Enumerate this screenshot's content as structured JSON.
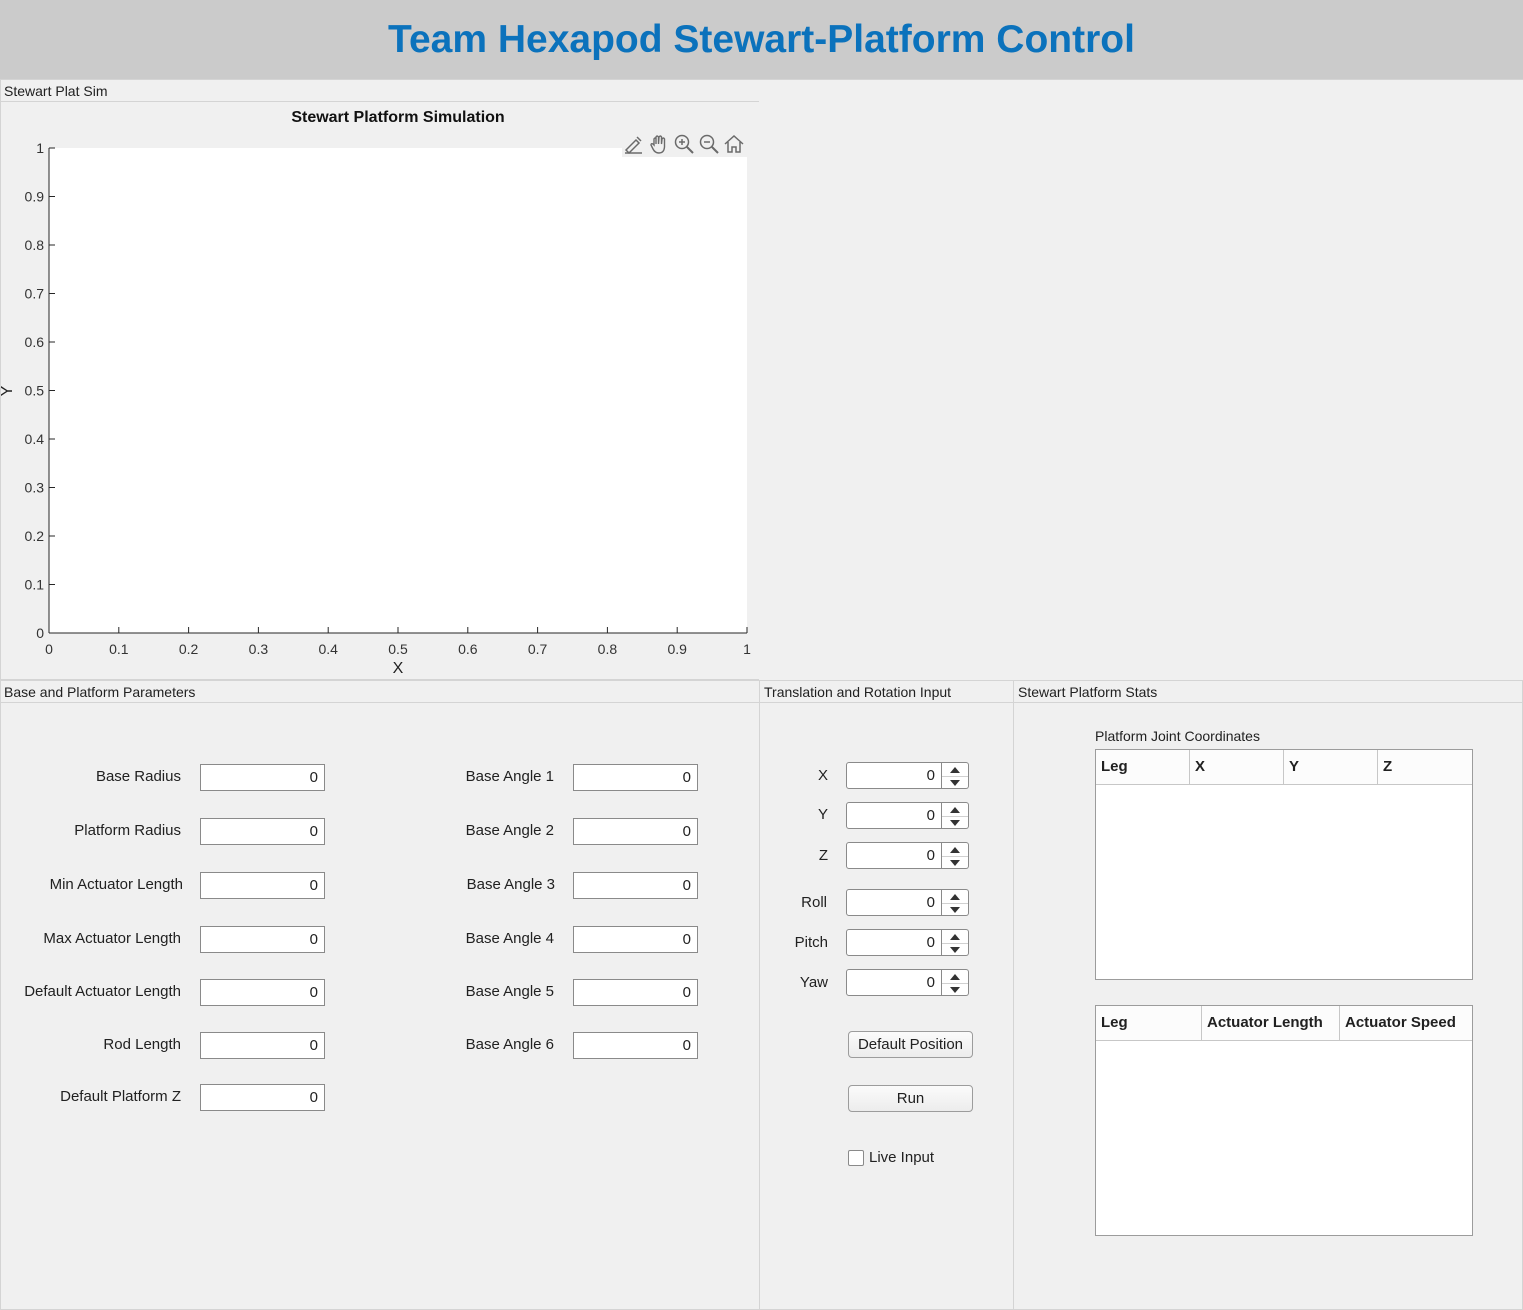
{
  "header": {
    "title": "Team Hexapod Stewart-Platform Control"
  },
  "sim_panel": {
    "title": "Stewart Plat Sim"
  },
  "chart_data": {
    "type": "line",
    "title": "Stewart Platform Simulation",
    "xlabel": "X",
    "ylabel": "Y",
    "xlim": [
      0,
      1
    ],
    "ylim": [
      0,
      1
    ],
    "xticks": [
      "0",
      "0.1",
      "0.2",
      "0.3",
      "0.4",
      "0.5",
      "0.6",
      "0.7",
      "0.8",
      "0.9",
      "1"
    ],
    "yticks": [
      "0",
      "0.1",
      "0.2",
      "0.3",
      "0.4",
      "0.5",
      "0.6",
      "0.7",
      "0.8",
      "0.9",
      "1"
    ],
    "series": [],
    "grid": false
  },
  "params_panel": {
    "title": "Base and Platform Parameters",
    "left_fields": [
      {
        "label": "Base Radius",
        "value": "0"
      },
      {
        "label": "Platform Radius",
        "value": "0"
      },
      {
        "label": "Min Actuator Length",
        "value": "0"
      },
      {
        "label": "Max Actuator Length",
        "value": "0"
      },
      {
        "label": "Default Actuator Length",
        "value": "0"
      },
      {
        "label": "Rod Length",
        "value": "0"
      },
      {
        "label": "Default Platform Z",
        "value": "0"
      }
    ],
    "right_fields": [
      {
        "label": "Base Angle 1",
        "value": "0"
      },
      {
        "label": "Base Angle 2",
        "value": "0"
      },
      {
        "label": "Base Angle 3",
        "value": "0"
      },
      {
        "label": "Base Angle 4",
        "value": "0"
      },
      {
        "label": "Base Angle 5",
        "value": "0"
      },
      {
        "label": "Base Angle 6",
        "value": "0"
      }
    ]
  },
  "input_panel": {
    "title": "Translation and Rotation Input",
    "spinners": [
      {
        "label": "X",
        "value": "0"
      },
      {
        "label": "Y",
        "value": "0"
      },
      {
        "label": "Z",
        "value": "0"
      },
      {
        "label": "Roll",
        "value": "0"
      },
      {
        "label": "Pitch",
        "value": "0"
      },
      {
        "label": "Yaw",
        "value": "0"
      }
    ],
    "default_button": "Default Position",
    "run_button": "Run",
    "live_input_label": "Live Input",
    "live_input_checked": false
  },
  "stats_panel": {
    "title": "Stewart Platform Stats",
    "joint_table_title": "Platform Joint Coordinates",
    "joint_table_columns": [
      "Leg",
      "X",
      "Y",
      "Z"
    ],
    "actuator_table_columns": [
      "Leg",
      "Actuator Length",
      "Actuator Speed"
    ]
  },
  "axes_toolbar": [
    "brush-icon",
    "pan-hand-icon",
    "zoom-in-icon",
    "zoom-out-icon",
    "home-icon"
  ]
}
